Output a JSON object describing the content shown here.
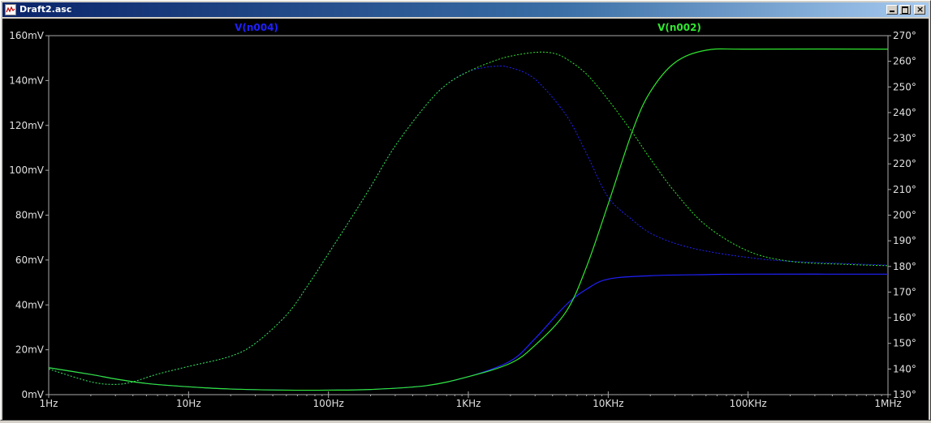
{
  "window": {
    "title": "Draft2.asc",
    "controls": [
      "minimize",
      "maximize",
      "close"
    ]
  },
  "colors": {
    "background": "#000000",
    "axis": "#aaaaaa",
    "grid": "#808080",
    "series_blue": "#2020ff",
    "series_green": "#30e830",
    "titlebar_start": "#0a246a",
    "titlebar_end": "#a6caf0"
  },
  "chart_data": {
    "type": "line",
    "x_scale": "log",
    "xlim": [
      1,
      1000000
    ],
    "x_ticks": [
      1,
      10,
      100,
      1000,
      10000,
      100000,
      1000000
    ],
    "x_tick_labels": [
      "1Hz",
      "10Hz",
      "100Hz",
      "1KHz",
      "10KHz",
      "100KHz",
      "1MHz"
    ],
    "ylim_left": [
      0,
      160
    ],
    "y_ticks_left": [
      0,
      20,
      40,
      60,
      80,
      100,
      120,
      140,
      160
    ],
    "y_tick_labels_left": [
      "0mV",
      "20mV",
      "40mV",
      "60mV",
      "80mV",
      "100mV",
      "120mV",
      "140mV",
      "160mV"
    ],
    "ylim_right": [
      130,
      270
    ],
    "y_ticks_right": [
      130,
      140,
      150,
      160,
      170,
      180,
      190,
      200,
      210,
      220,
      230,
      240,
      250,
      260,
      270
    ],
    "y_tick_labels_right": [
      "130°",
      "140°",
      "150°",
      "160°",
      "170°",
      "180°",
      "190°",
      "200°",
      "210°",
      "220°",
      "230°",
      "240°",
      "250°",
      "260°",
      "270°"
    ],
    "legend_placement": "top",
    "series": [
      {
        "name": "V(n004)",
        "color": "#2020ff",
        "magnitude_mV": {
          "x": [
            1,
            2,
            3,
            5,
            10,
            20,
            50,
            100,
            200,
            500,
            1000,
            2000,
            3000,
            5000,
            7000,
            10000,
            20000,
            50000,
            100000,
            1000000
          ],
          "y": [
            12,
            9,
            7,
            5,
            3.5,
            2.5,
            2,
            2,
            2.3,
            4,
            8,
            15,
            25,
            40,
            47,
            51.5,
            53,
            53.5,
            53.7,
            53.7
          ]
        },
        "phase_deg": {
          "x": [
            1,
            2,
            3,
            4,
            6,
            10,
            20,
            30,
            50,
            70,
            100,
            150,
            200,
            300,
            500,
            700,
            1000,
            1500,
            2000,
            3000,
            5000,
            7000,
            10000,
            15000,
            20000,
            30000,
            50000,
            100000,
            200000,
            1000000
          ],
          "y": [
            140,
            135,
            134,
            135,
            138,
            141,
            145,
            150,
            161,
            172,
            185,
            200,
            211,
            227,
            243,
            251,
            256,
            258,
            257.5,
            253,
            239,
            224,
            207,
            198,
            193,
            189,
            186,
            183.5,
            182,
            180.5
          ]
        }
      },
      {
        "name": "V(n002)",
        "color": "#30e830",
        "magnitude_mV": {
          "x": [
            1,
            2,
            3,
            5,
            10,
            20,
            50,
            100,
            200,
            500,
            1000,
            2000,
            3000,
            5000,
            7000,
            10000,
            15000,
            20000,
            30000,
            50000,
            100000,
            1000000
          ],
          "y": [
            12,
            9,
            7,
            5,
            3.5,
            2.5,
            2,
            2,
            2.3,
            4,
            8,
            14,
            22,
            37,
            57,
            85,
            118,
            135,
            148,
            153.5,
            154,
            154
          ]
        },
        "phase_deg": {
          "x": [
            1,
            2,
            3,
            4,
            6,
            10,
            20,
            30,
            50,
            70,
            100,
            150,
            200,
            300,
            500,
            700,
            1000,
            1500,
            2000,
            3000,
            4000,
            5000,
            7000,
            10000,
            15000,
            20000,
            30000,
            50000,
            100000,
            200000,
            500000,
            1000000
          ],
          "y": [
            140,
            135,
            134,
            135,
            138,
            141,
            145,
            150,
            161,
            172,
            185,
            200,
            211,
            227,
            243,
            251,
            256,
            260,
            262,
            263.5,
            263.2,
            261,
            255,
            245,
            232,
            222,
            209,
            196,
            186,
            182,
            180.8,
            180.3
          ]
        }
      }
    ]
  }
}
